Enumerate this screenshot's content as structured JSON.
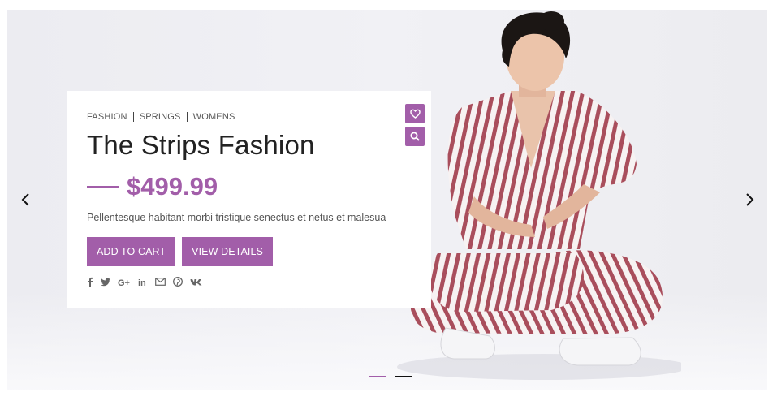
{
  "slide": {
    "categories": [
      "FASHION",
      "SPRINGS",
      "WOMENS"
    ],
    "title": "The Strips Fashion",
    "price": "$499.99",
    "description": "Pellentesque habitant morbi tristique senectus et netus et malesua",
    "buttons": {
      "add_to_cart": "ADD TO CART",
      "view_details": "VIEW DETAILS"
    },
    "social_icons": [
      "facebook-icon",
      "twitter-icon",
      "google-plus-icon",
      "linkedin-icon",
      "envelope-icon",
      "pinterest-icon",
      "vk-icon"
    ],
    "actions": [
      "heart-icon",
      "search-icon"
    ]
  },
  "navigation": {
    "prev_icon": "chevron-left-icon",
    "next_icon": "chevron-right-icon",
    "dots_total": 2,
    "active_dot": 1
  },
  "colors": {
    "accent": "#a25ea9",
    "text_dark": "#222222",
    "text_muted": "#555555",
    "background": "#eeeef2"
  }
}
